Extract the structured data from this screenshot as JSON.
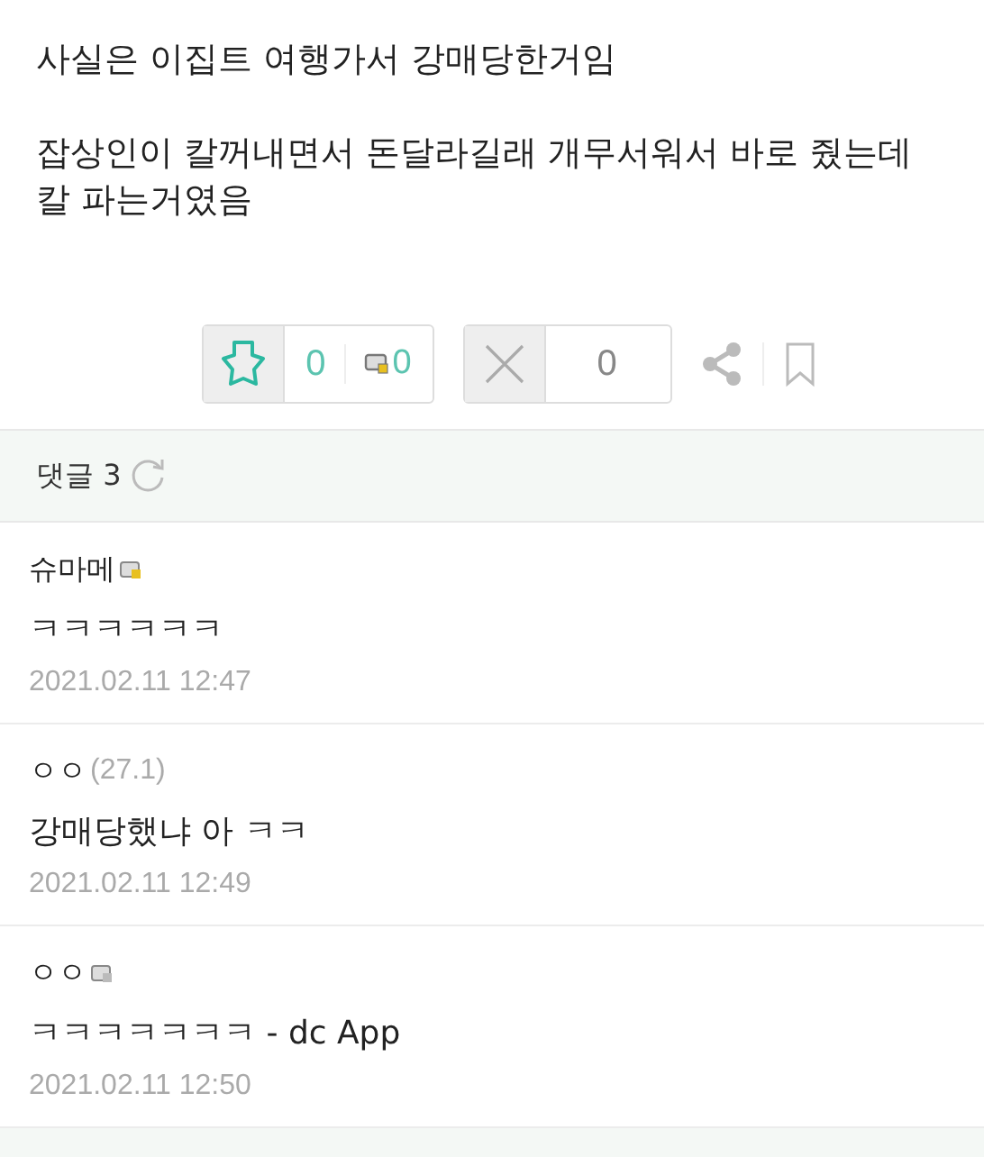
{
  "post": {
    "paragraphs": [
      "사실은 이집트 여행가서 강매당한거임",
      "잡상인이 칼꺼내면서 돈달라길래 개무서워서 바로 줬는데 칼 파는거였음"
    ]
  },
  "votes": {
    "up_count": "0",
    "member_up_count": "0",
    "down_count": "0"
  },
  "comments_header": {
    "label": "댓글",
    "count": "3"
  },
  "comments": [
    {
      "author": "슈마메",
      "color": "#e8c020",
      "text": "ㅋㅋㅋㅋㅋㅋ",
      "time": "2021.02.11 12:47"
    },
    {
      "author": "ㅇㅇ",
      "ip": "(27.1)",
      "text": "강매당했냐 아 ㅋㅋ",
      "time": "2021.02.11 12:49"
    },
    {
      "author": "ㅇㅇ",
      "color": "#bbbbbb",
      "text": "ㅋㅋㅋㅋㅋㅋㅋ - dc App",
      "time": "2021.02.11 12:50"
    }
  ]
}
